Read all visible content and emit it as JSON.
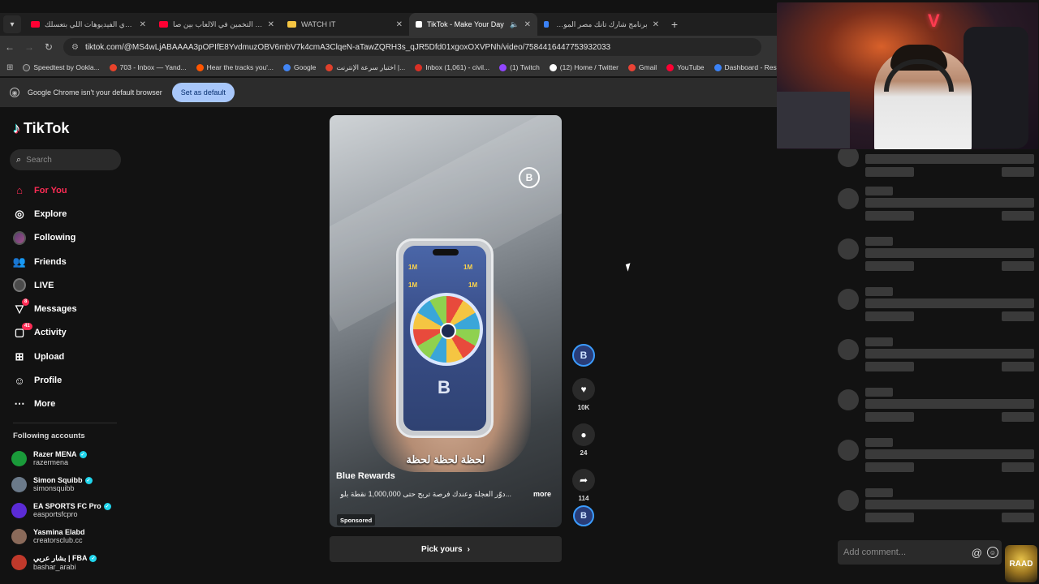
{
  "browser": {
    "tabs": [
      {
        "title": "هي دي الفيديوهات اللي بتعسلك",
        "favicon_color": "#ff0033",
        "active": false,
        "audio": false
      },
      {
        "title": "تحدي التخمين في الالعاب بين صا",
        "favicon_color": "#ff0033",
        "active": false,
        "audio": false
      },
      {
        "title": "WATCH IT",
        "favicon_color": "#f5c542",
        "active": false,
        "audio": false
      },
      {
        "title": "TikTok - Make Your Day",
        "favicon_color": "#ffffff",
        "active": true,
        "audio": true
      },
      {
        "title": "برنامج شارك تانك مصر الموسم ال",
        "favicon_color": "#3b82f6",
        "active": false,
        "audio": false
      }
    ],
    "url": "tiktok.com/@MS4wLjABAAAA3pOPIfE8YvdmuzOBV6mbV7k4cmA3ClqeN-aTawZQRH3s_qJR5Dfd01xgoxOXVPNh/video/7584416447753932033",
    "bookmarks": [
      {
        "label": "Speedtest by Ookla...",
        "color": "#444"
      },
      {
        "label": "703 - Inbox — Yand...",
        "color": "#e8432b"
      },
      {
        "label": "Hear the tracks you'...",
        "color": "#ff5500"
      },
      {
        "label": "Google",
        "color": "#4285f4"
      },
      {
        "label": "اختبار سرعة الإنترنت |...",
        "color": "#e0402b"
      },
      {
        "label": "Inbox (1,061) - civil...",
        "color": "#d93025"
      },
      {
        "label": "(1) Twitch",
        "color": "#9146ff"
      },
      {
        "label": "(12) Home / Twitter",
        "color": "#ffffff"
      },
      {
        "label": "Gmail",
        "color": "#ea4335"
      },
      {
        "label": "YouTube",
        "color": "#ff0033"
      },
      {
        "label": "Dashboard - Restre...",
        "color": "#3b82f6"
      }
    ],
    "infobar": {
      "message": "Google Chrome isn't your default browser",
      "button": "Set as default"
    }
  },
  "tiktok": {
    "brand": "TikTok",
    "search_placeholder": "Search",
    "nav": [
      {
        "label": "For You",
        "icon": "home-icon",
        "active": true
      },
      {
        "label": "Explore",
        "icon": "compass-icon",
        "active": false
      },
      {
        "label": "Following",
        "icon": "avatar-icon",
        "active": false
      },
      {
        "label": "Friends",
        "icon": "people-icon",
        "active": false
      },
      {
        "label": "LIVE",
        "icon": "live-icon",
        "active": false
      },
      {
        "label": "Messages",
        "icon": "send-icon",
        "active": false,
        "badge": "8"
      },
      {
        "label": "Activity",
        "icon": "inbox-icon",
        "active": false,
        "badge": "41"
      },
      {
        "label": "Upload",
        "icon": "plus-square-icon",
        "active": false
      },
      {
        "label": "Profile",
        "icon": "profile-icon",
        "active": false
      },
      {
        "label": "More",
        "icon": "more-icon",
        "active": false
      }
    ],
    "following_title": "Following accounts",
    "following": [
      {
        "name": "Razer MENA",
        "handle": "razermena",
        "verified": true,
        "color": "#1a9b3a"
      },
      {
        "name": "Simon Squibb",
        "handle": "simonsquibb",
        "verified": true,
        "color": "#6b7a8a"
      },
      {
        "name": "EA SPORTS FC Pro",
        "handle": "easportsfcpro",
        "verified": true,
        "color": "#5b2bd6"
      },
      {
        "name": "Yasmina Elabd",
        "handle": "creatorsclub.cc",
        "verified": false,
        "color": "#8a6a5a"
      },
      {
        "name": "بشار عربي | FBA",
        "handle": "bashar_arabi",
        "verified": true,
        "color": "#c0392b"
      }
    ],
    "video": {
      "brand_badge": "B",
      "caption": "لحظة لحظة لحظة",
      "author": "Blue Rewards",
      "description": "دوّر العجلة وعندك فرصة تربح حتى 1,000,000 نقطة بلو...",
      "more": "more",
      "sponsored": "Sponsored",
      "phone_letter": "B",
      "phone_prize": "1M"
    },
    "cta": "Pick yours",
    "actions": {
      "avatar": "B",
      "likes": "10K",
      "comments": "24",
      "shares": "114",
      "music": "B"
    }
  },
  "comments_panel": {
    "placeholder": "Add comment...",
    "skeleton_rows": 8,
    "overlay_badge": "RAAD"
  }
}
